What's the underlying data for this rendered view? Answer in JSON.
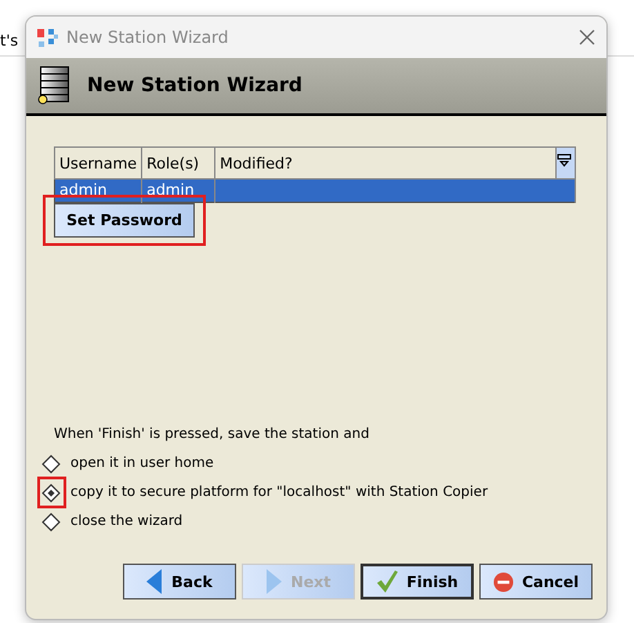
{
  "background_text": "t's",
  "window": {
    "title": "New Station Wizard"
  },
  "header": {
    "title": "New Station Wizard"
  },
  "table": {
    "columns": [
      "Username",
      "Role(s)",
      "Modified?"
    ],
    "rows": [
      {
        "cells": [
          "admin",
          "admin",
          ""
        ],
        "selected": true
      }
    ]
  },
  "set_password_button": {
    "label": "Set Password",
    "highlighted": true
  },
  "finish_options": {
    "intro": "When 'Finish' is pressed, save the station and",
    "options": [
      {
        "label": "open it in user home",
        "selected": false,
        "highlighted": false
      },
      {
        "label": "copy it to secure platform for \"localhost\" with Station Copier",
        "selected": true,
        "highlighted": true
      },
      {
        "label": "close the wizard",
        "selected": false,
        "highlighted": false
      }
    ]
  },
  "buttons": [
    {
      "kind": "back",
      "label": "Back",
      "disabled": false,
      "default": false
    },
    {
      "kind": "next",
      "label": "Next",
      "disabled": true,
      "default": false
    },
    {
      "kind": "finish",
      "label": "Finish",
      "disabled": false,
      "default": true
    },
    {
      "kind": "cancel",
      "label": "Cancel",
      "disabled": false,
      "default": false
    }
  ]
}
